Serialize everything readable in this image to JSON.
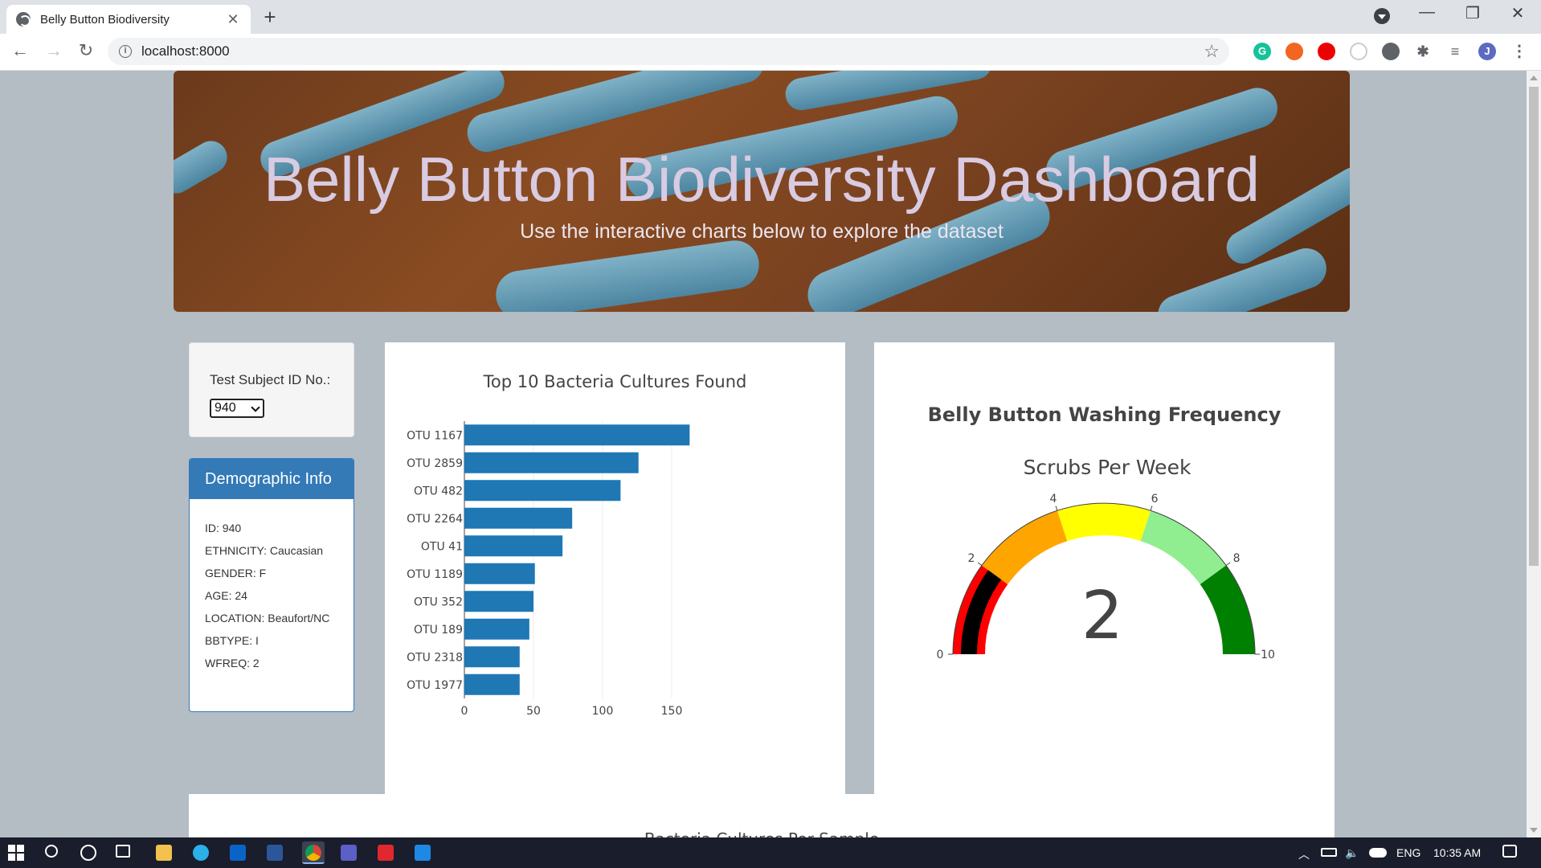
{
  "browser": {
    "tab_title": "Belly Button Biodiversity",
    "url": "localhost:8000",
    "profile_initial": "J",
    "extension_initial": "G"
  },
  "hero": {
    "title": "Belly Button Biodiversity Dashboard",
    "subtitle": "Use the interactive charts below to explore the dataset"
  },
  "selector": {
    "label": "Test Subject ID No.:",
    "value": "940"
  },
  "demographics": {
    "heading": "Demographic Info",
    "rows": [
      "ID: 940",
      "ETHNICITY: Caucasian",
      "GENDER: F",
      "AGE: 24",
      "LOCATION: Beaufort/NC",
      "BBTYPE: I",
      "WFREQ: 2"
    ]
  },
  "bar_chart": {
    "type": "bar",
    "title": "Top 10 Bacteria Cultures Found",
    "orientation": "horizontal",
    "categories": [
      "OTU 1167",
      "OTU 2859",
      "OTU 482",
      "OTU 2264",
      "OTU 41",
      "OTU 1189",
      "OTU 352",
      "OTU 189",
      "OTU 2318",
      "OTU 1977"
    ],
    "values": [
      163,
      126,
      113,
      78,
      71,
      51,
      50,
      47,
      40,
      40
    ],
    "xlim": [
      0,
      175
    ],
    "xticks": [
      "0",
      "50",
      "100",
      "150"
    ],
    "color": "#1f77b4"
  },
  "gauge_chart": {
    "type": "gauge",
    "title": "Belly Button Washing Frequency",
    "subtitle": "Scrubs Per Week",
    "value": 2,
    "value_label": "2",
    "range": [
      0,
      10
    ],
    "ticks": [
      "0",
      "2",
      "4",
      "6",
      "8",
      "10"
    ],
    "bands": [
      {
        "from": 0,
        "to": 2,
        "color": "#ff0000"
      },
      {
        "from": 2,
        "to": 4,
        "color": "#ffa500"
      },
      {
        "from": 4,
        "to": 6,
        "color": "#ffff00"
      },
      {
        "from": 6,
        "to": 8,
        "color": "#90ee90"
      },
      {
        "from": 8,
        "to": 10,
        "color": "#008000"
      }
    ],
    "bar_color": "#000000"
  },
  "bubble_chart": {
    "title": "Bacteria Cultures Per Sample"
  },
  "taskbar": {
    "language": "ENG",
    "time": "10:35 AM"
  }
}
